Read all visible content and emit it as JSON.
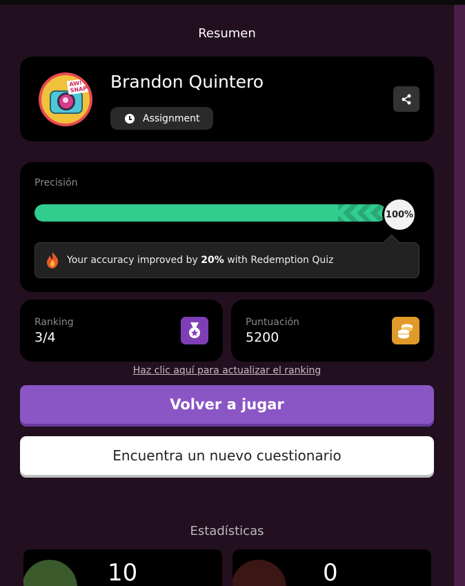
{
  "header": {
    "title": "Resumen"
  },
  "profile": {
    "avatar_text": "AW! SNAP!",
    "name": "Brandon Quintero",
    "mode_chip": "Assignment"
  },
  "accuracy": {
    "label": "Precisión",
    "percent_text": "100%",
    "percent_value": 100,
    "notice_prefix": "Your accuracy improved by",
    "notice_bold": "20%",
    "notice_suffix": "with Redemption Quiz"
  },
  "stats": {
    "ranking_label": "Ranking",
    "ranking_value": "3/4",
    "score_label": "Puntuación",
    "score_value": "5200"
  },
  "refresh_link": "Haz clic aquí para actualizar el ranking",
  "buttons": {
    "play_again": "Volver a jugar",
    "find_new": "Encuentra un nuevo cuestionario"
  },
  "statistics": {
    "title": "Estadísticas",
    "correct_count": "10",
    "incorrect_count": "0"
  },
  "colors": {
    "background": "#220f1f",
    "progress": "#30cd8f",
    "primary_button": "#8a55c4",
    "ranking_icon_bg": "#7e3fb6",
    "score_icon_bg": "#e09a29"
  }
}
